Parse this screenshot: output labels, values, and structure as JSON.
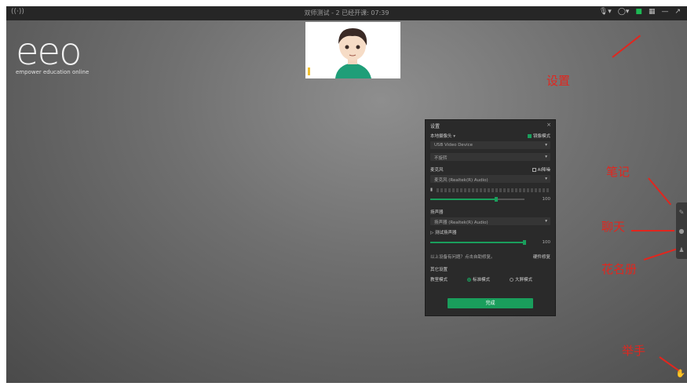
{
  "titlebar": {
    "signal_icon": "((·))",
    "title": "双师测试 - 2   已经开课: 07:39",
    "right_icons": [
      "mic-icon",
      "headset-icon",
      "camera-icon",
      "grid-icon",
      "minimize-icon",
      "expand-icon"
    ]
  },
  "logo": {
    "mark": "eeo",
    "tagline": "empower education online"
  },
  "annotations": {
    "settings": "设置",
    "notes": "笔记",
    "chat": "聊天",
    "roster": "花名册",
    "raise_hand": "举手"
  },
  "settings_dialog": {
    "title": "设置",
    "close": "×",
    "camera_label": "本地摄像头",
    "mirror_label": "镜像模式",
    "camera_device": "USB Video Device",
    "camera_rotation": "不旋转",
    "mic_label": "麦克风",
    "ai_denoise_label": "AI降噪",
    "mic_device": "麦克风 (Realtek(R) Audio)",
    "mic_volume": "100",
    "speaker_label": "扬声器",
    "speaker_device": "扬声器 (Realtek(R) Audio)",
    "speaker_test_label": "测试扬声器",
    "speaker_volume": "100",
    "problem_text": "以上设备有问题？点击自助修复。",
    "repair_link": "硬件修复",
    "other_label": "其它设置",
    "classroom_mode_label": "教室模式",
    "mode_standard": "标准模式",
    "mode_big": "大屏模式",
    "done_button": "完成"
  },
  "colors": {
    "accent": "#1a9e5c",
    "annotation": "#e2261e"
  }
}
